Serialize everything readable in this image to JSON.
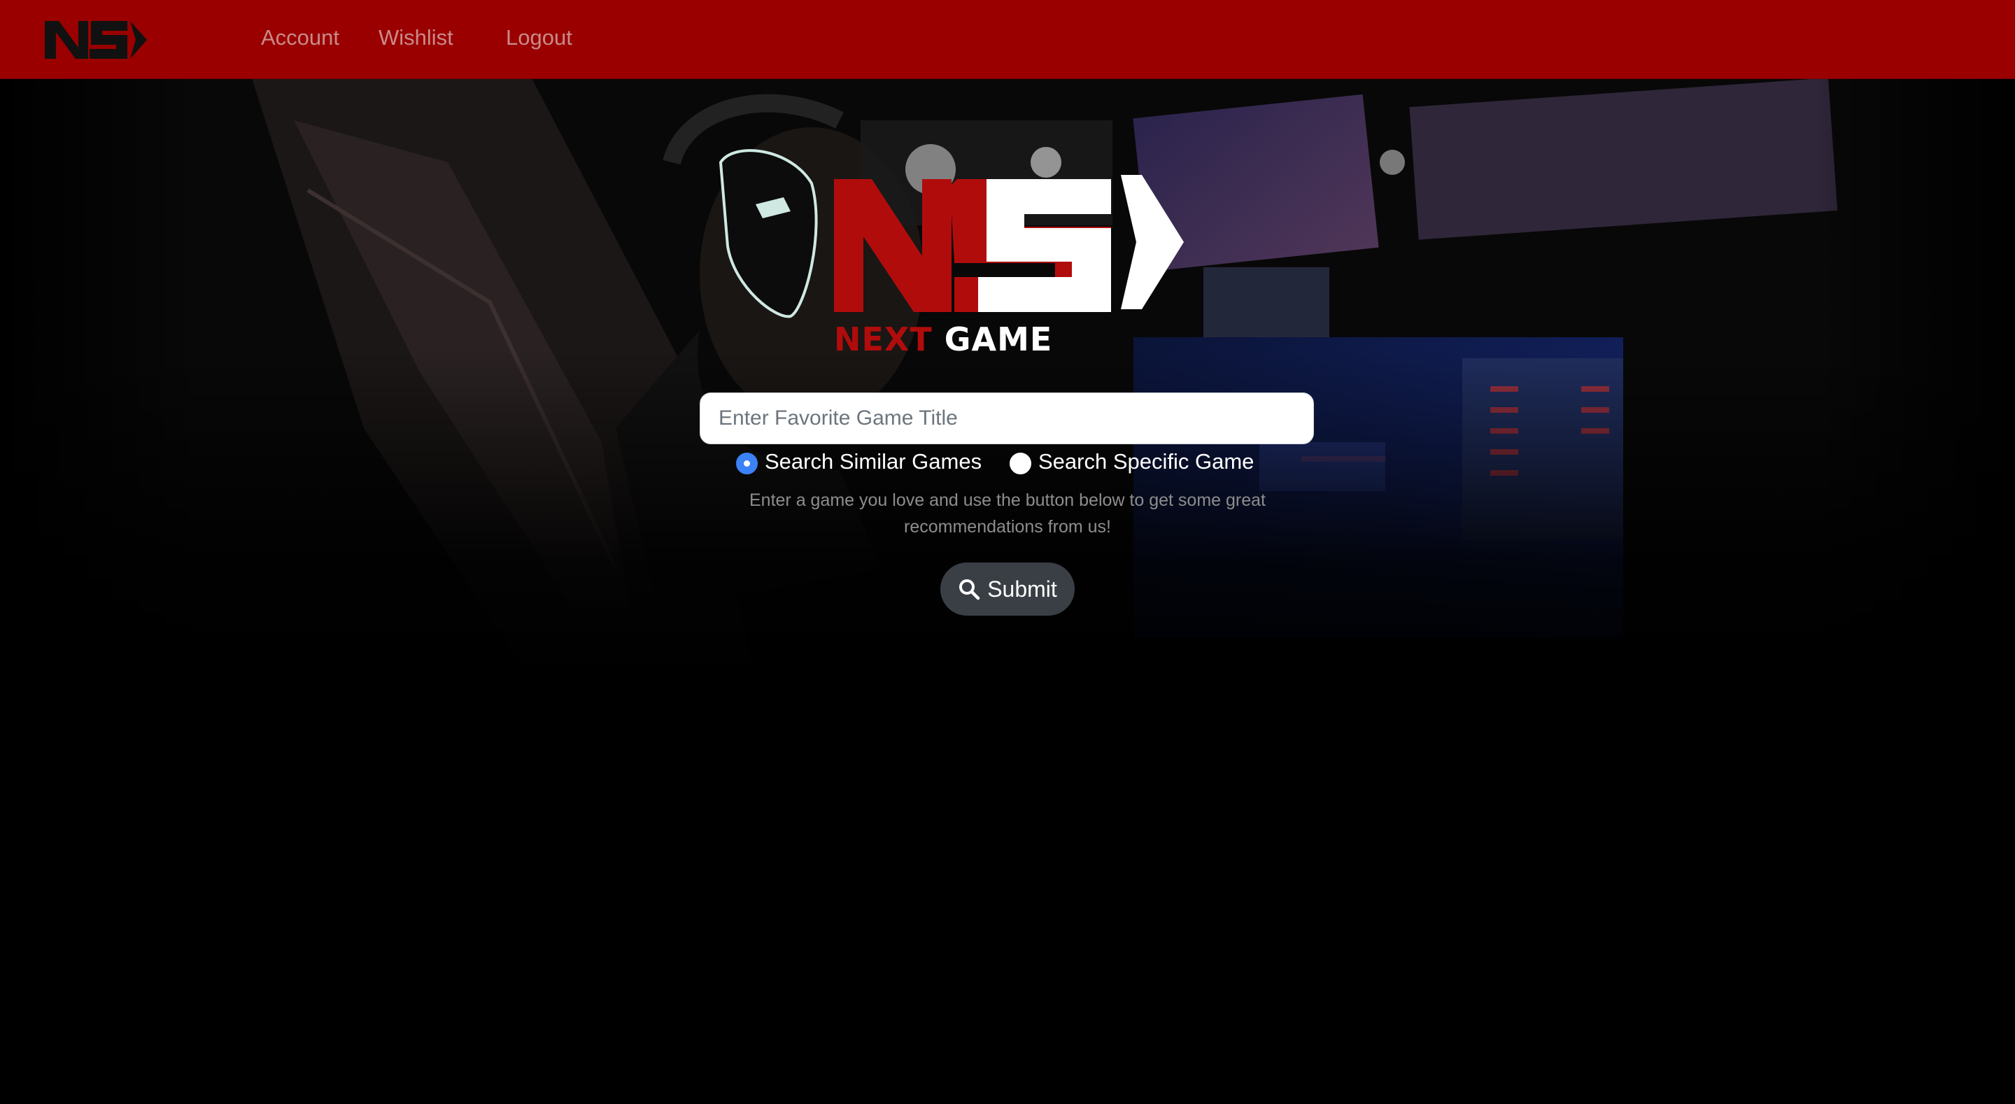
{
  "navbar": {
    "logo_icon": "next-game-ng-logo",
    "links": {
      "account": "Account",
      "wishlist": "Wishlist",
      "logout": "Logout"
    },
    "background_color": "#9a0000"
  },
  "hero": {
    "background_image": "gamer-with-headset-esports-arena",
    "brand": {
      "word_red": "NEXT",
      "word_white": "GAME"
    }
  },
  "search": {
    "placeholder": "Enter Favorite Game Title",
    "value": "",
    "options": [
      {
        "label": "Search Similar Games",
        "checked": true
      },
      {
        "label": "Search Specific Game",
        "checked": false
      }
    ],
    "helper_text": "Enter a game you love and use the button below to get some great recommendations from us!",
    "submit_label": "Submit",
    "submit_icon": "search-icon"
  },
  "colors": {
    "brand_red": "#b10c0c",
    "radio_accent": "#3b82f6",
    "submit_bg": "#3a3f45"
  }
}
